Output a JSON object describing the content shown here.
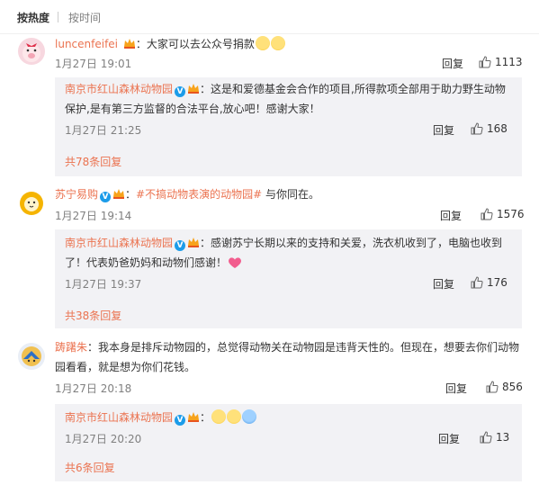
{
  "sort": {
    "hot": "按热度",
    "time": "按时间"
  },
  "comments": [
    {
      "user": "luncenfeifei",
      "text": "：大家可以去公众号捐款",
      "time": "1月27日 19:01",
      "reply_label": "回复",
      "likes": "1113",
      "reply": {
        "user": "南京市红山森林动物园",
        "text": "：这是和爱德基金会合作的项目,所得款项全部用于助力野生动物保护,是有第三方监督的合法平台,放心吧！感谢大家！",
        "time": "1月27日 21:25",
        "reply_label": "回复",
        "likes": "168"
      },
      "more": "共78条回复"
    },
    {
      "user": "苏宁易购",
      "topic": "#不搞动物表演的动物园#",
      "text": " 与你同在。",
      "time": "1月27日 19:14",
      "reply_label": "回复",
      "likes": "1576",
      "reply": {
        "user": "南京市红山森林动物园",
        "text": "：感谢苏宁长期以来的支持和关爱，洗衣机收到了，电脑也收到了！代表奶爸奶妈和动物们感谢！",
        "time": "1月27日 19:37",
        "reply_label": "回复",
        "likes": "176"
      },
      "more": "共38条回复"
    },
    {
      "user": "踌躇朱",
      "text": "：我本身是排斥动物园的，总觉得动物关在动物园是违背天性的。但现在，想要去你们动物园看看，就是想为你们花钱。",
      "time": "1月27日 20:18",
      "reply_label": "回复",
      "likes": "856",
      "reply": {
        "user": "南京市红山森林动物园",
        "text": "：",
        "time": "1月27日 20:20",
        "reply_label": "回复",
        "likes": "13"
      },
      "more": "共6条回复"
    }
  ],
  "colors": {
    "link": "#eb7350",
    "reply_bg": "#f2f2f5",
    "verified": "#1c9ce9"
  }
}
